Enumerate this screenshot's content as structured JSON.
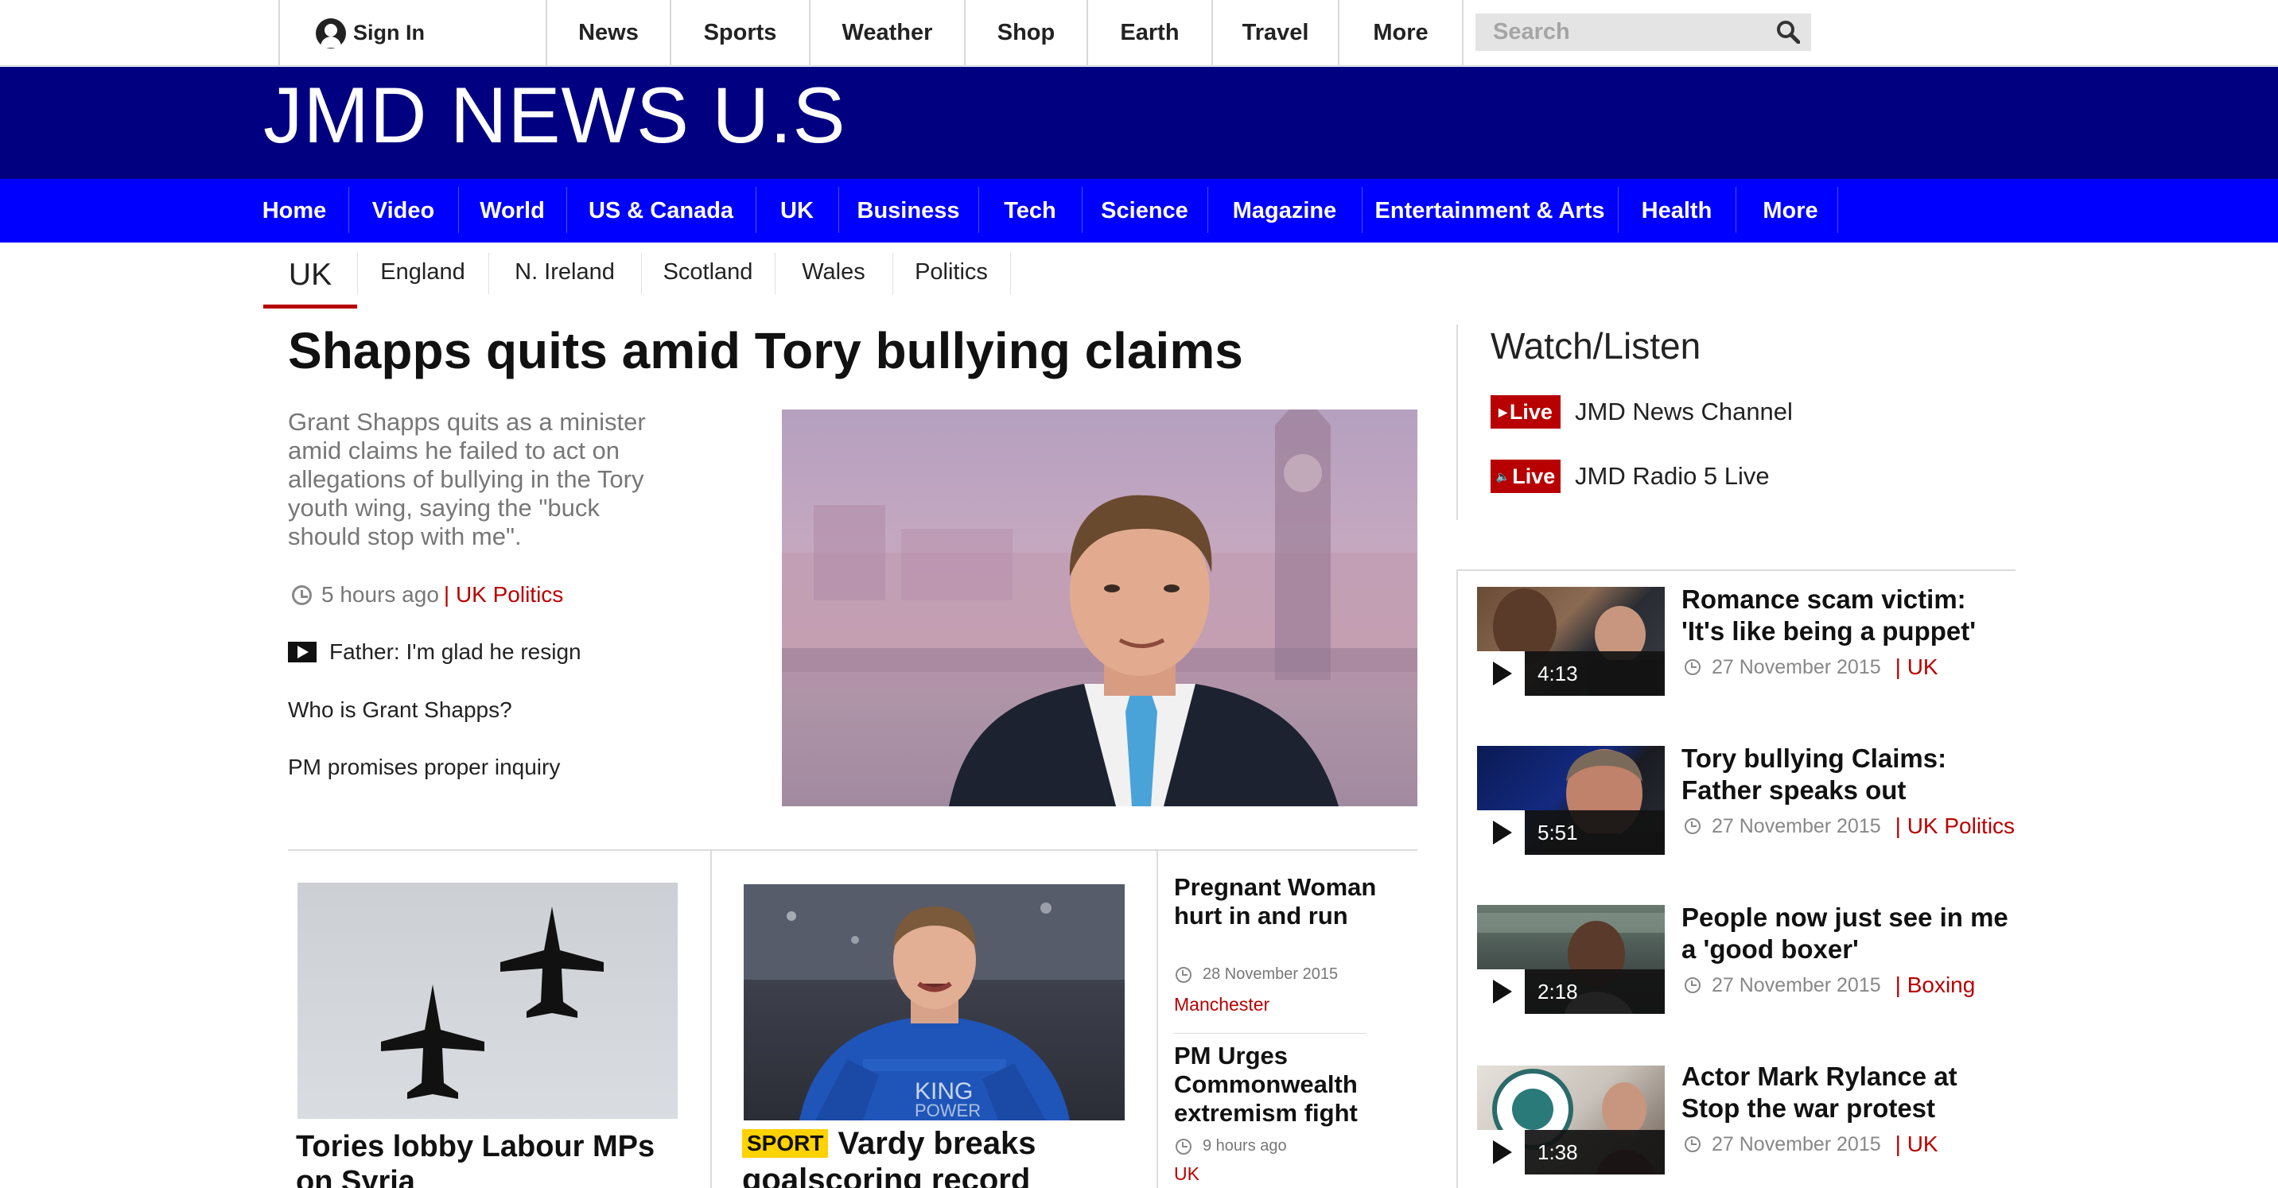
{
  "topbar": {
    "signin_label": "Sign In",
    "nav": [
      "News",
      "Sports",
      "Weather",
      "Shop",
      "Earth",
      "Travel",
      "More"
    ],
    "search_placeholder": "Search"
  },
  "masthead": {
    "brand": "JMD NEWS U.S"
  },
  "main_nav": [
    "Home",
    "Video",
    "World",
    "US & Canada",
    "UK",
    "Business",
    "Tech",
    "Science",
    "Magazine",
    "Entertainment & Arts",
    "Health",
    "More"
  ],
  "sub_nav": {
    "current": "UK",
    "items": [
      "England",
      "N. Ireland",
      "Scotland",
      "Wales",
      "Politics"
    ]
  },
  "top_story": {
    "headline": "Shapps quits amid Tory bullying claims",
    "summary": "Grant Shapps quits as a minister amid claims he failed to act on allegations of bullying in the Tory youth wing, saying the \"buck should stop with me\".",
    "time": "5 hours ago",
    "section": "| UK Politics",
    "related": [
      "Father: I'm glad he resign",
      "Who is Grant Shapps?",
      "PM promises proper inquiry"
    ]
  },
  "stories": {
    "syria": {
      "title": "Tories lobby Labour MPs on Syria"
    },
    "vardy": {
      "tag": "SPORT",
      "title_line1": "Vardy breaks",
      "title_line2": "goalscoring record"
    },
    "mini": [
      {
        "title": "Pregnant Woman hurt in and run",
        "date": "28 November 2015",
        "location": "Manchester"
      },
      {
        "title": "PM Urges Commonwealth extremism fight",
        "date": "9 hours ago",
        "location": "UK"
      }
    ]
  },
  "watch_listen": {
    "title": "Watch/Listen",
    "live_label": "Live",
    "items": [
      "JMD News Channel",
      "JMD Radio 5 Live"
    ]
  },
  "videos": [
    {
      "duration": "4:13",
      "title": "Romance scam victim: 'It's like being a puppet'",
      "date": "27 November 2015",
      "section": "| UK"
    },
    {
      "duration": "5:51",
      "title": "Tory bullying Claims: Father speaks out",
      "date": "27 November 2015",
      "section": "| UK Politics"
    },
    {
      "duration": "2:18",
      "title": "People now just see in me a 'good boxer'",
      "date": "27 November 2015",
      "section": "| Boxing"
    },
    {
      "duration": "1:38",
      "title": "Actor Mark Rylance at Stop the war protest",
      "date": "27 November 2015",
      "section": "| UK"
    }
  ],
  "colors": {
    "masthead": "#000080",
    "main_nav": "#0000ff",
    "accent_red": "#b80000",
    "sport_tag": "#ffd200"
  }
}
